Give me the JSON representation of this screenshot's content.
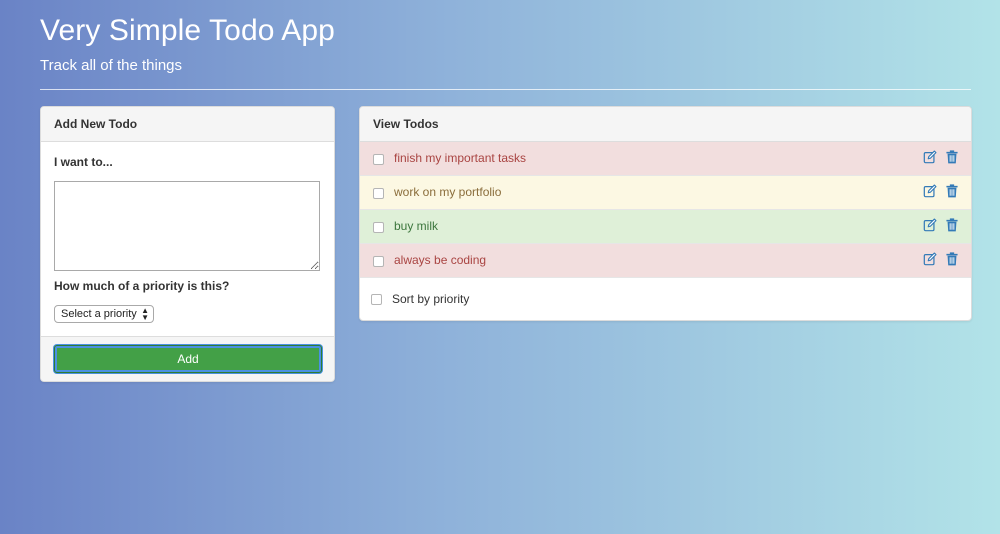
{
  "header": {
    "title": "Very Simple Todo App",
    "subtitle": "Track all of the things"
  },
  "add_panel": {
    "heading": "Add New Todo",
    "todo_label": "I want to...",
    "todo_value": "",
    "priority_label": "How much of a priority is this?",
    "priority_selected": "Select a priority",
    "add_button": "Add"
  },
  "view_panel": {
    "heading": "View Todos",
    "todos": [
      {
        "text": "finish my important tasks",
        "bg": "#f2dede",
        "color": "#a94442"
      },
      {
        "text": "work on my portfolio",
        "bg": "#fcf8e3",
        "color": "#8a6d3b"
      },
      {
        "text": "buy milk",
        "bg": "#dff0d8",
        "color": "#3c763d"
      },
      {
        "text": "always be coding",
        "bg": "#f2dede",
        "color": "#a94442"
      }
    ],
    "sort_label": "Sort by priority"
  },
  "colors": {
    "accent_blue": "#337ab7",
    "add_button_green": "#43a047"
  }
}
